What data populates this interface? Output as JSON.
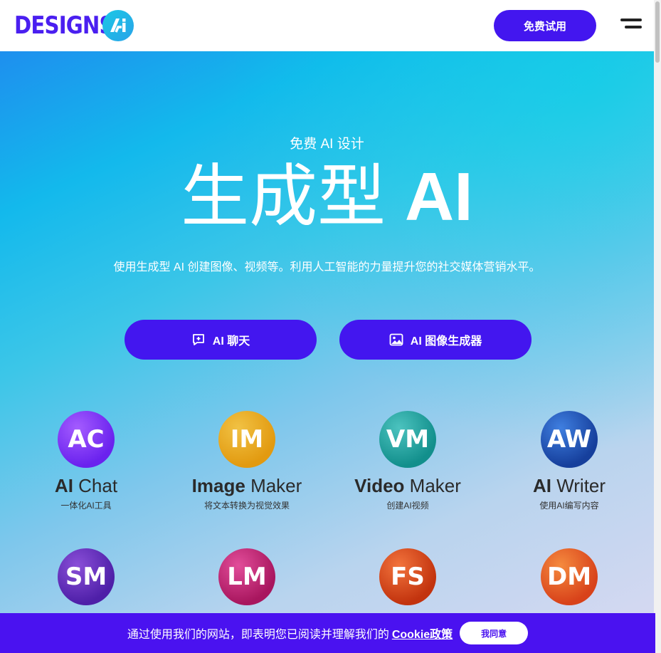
{
  "header": {
    "logo_text": "DESIGNS.",
    "logo_badge_text": "Ai",
    "trial_button": "免费试用",
    "menu_icon": "hamburger-menu-icon"
  },
  "hero": {
    "eyebrow": "免费 AI 设计",
    "headline_cn": "生成型",
    "headline_en": "AI",
    "subtitle": "使用生成型 AI 创建图像、视频等。利用人工智能的力量提升您的社交媒体营销水平。",
    "cta_chat": "AI 聊天",
    "cta_chat_icon": "chat-plus-icon",
    "cta_image": "AI 图像生成器",
    "cta_image_icon": "image-icon"
  },
  "tools": [
    {
      "abbr": "AC",
      "name_bold": "AI",
      "name_rest": "Chat",
      "desc": "一体化AI工具",
      "color": "#7a2ff0"
    },
    {
      "abbr": "IM",
      "name_bold": "Image",
      "name_rest": "Maker",
      "desc": "将文本转换为视觉效果",
      "color": "#e6a417"
    },
    {
      "abbr": "VM",
      "name_bold": "Video",
      "name_rest": "Maker",
      "desc": "创建AI视频",
      "color": "#1aa39f"
    },
    {
      "abbr": "AW",
      "name_bold": "AI",
      "name_rest": "Writer",
      "desc": "使用AI编写内容",
      "color": "#1d4fb0"
    },
    {
      "abbr": "SM",
      "color": "#5b28b8"
    },
    {
      "abbr": "LM",
      "color": "#c2257a"
    },
    {
      "abbr": "FS",
      "color": "#e0491d"
    },
    {
      "abbr": "DM",
      "color": "#e35a22"
    }
  ],
  "cookie": {
    "text": "通过使用我们的网站，即表明您已阅读并理解我们的",
    "link": "Cookie政策",
    "accept": "我同意"
  }
}
